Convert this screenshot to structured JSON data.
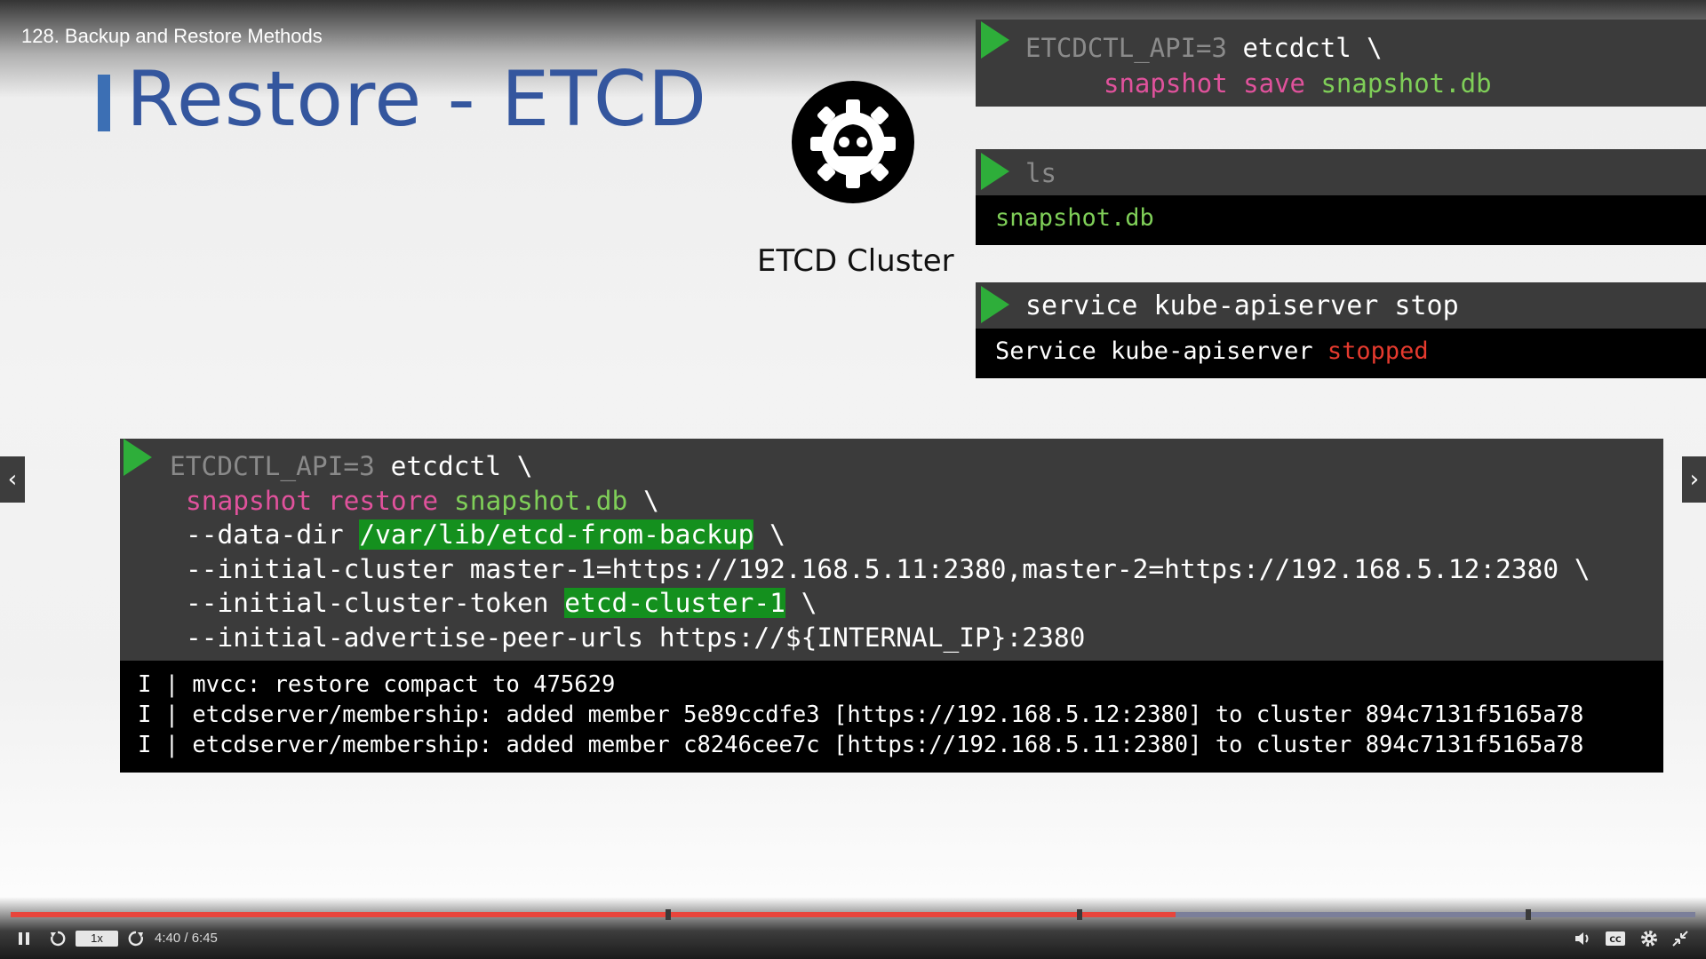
{
  "header": {
    "lecture_title": "128. Backup and Restore Methods"
  },
  "slide": {
    "title": "Restore - ETCD",
    "logo_label": "ETCD Cluster"
  },
  "term1": {
    "env": "ETCDCTL_API=3",
    "cmd": "etcdctl",
    "cont": "\\",
    "sub1": "snapshot",
    "sub2": "save",
    "file": "snapshot.db"
  },
  "term2": {
    "cmd": "ls",
    "output": "snapshot.db"
  },
  "term3": {
    "cmd": "service kube-apiserver stop",
    "output_prefix": "Service kube-apiserver",
    "output_status": "stopped"
  },
  "term4": {
    "env": "ETCDCTL_API=3",
    "cmd": "etcdctl",
    "cont": "\\",
    "sub1": "snapshot",
    "sub2": "restore",
    "file": "snapshot.db",
    "data_dir_flag": "--data-dir",
    "data_dir_value": "/var/lib/etcd-from-backup",
    "initial_cluster_line": "--initial-cluster master-1=https://192.168.5.11:2380,master-2=https://192.168.5.12:2380 \\",
    "token_flag": "--initial-cluster-token",
    "token_value": "etcd-cluster-1",
    "peer_urls_line": "--initial-advertise-peer-urls https://${INTERNAL_IP}:2380",
    "output": [
      "I | mvcc: restore compact to 475629",
      "I | etcdserver/membership: added member 5e89ccdfe3 [https://192.168.5.12:2380] to cluster 894c7131f5165a78",
      "I | etcdserver/membership: added member c8246cee7c [https://192.168.5.11:2380] to cluster 894c7131f5165a78"
    ]
  },
  "nav": {
    "prev": "‹",
    "next": "›"
  },
  "player": {
    "speed": "1x",
    "time": "4:40 / 6:45",
    "progress_fraction": 0.6912,
    "played_color": "#e8453c",
    "track_color": "#7b7f9a",
    "chapter_mark_fractions": [
      0.3905,
      0.6345,
      0.901
    ],
    "icons": [
      "pause-icon",
      "rewind-icon",
      "forward-icon",
      "volume-icon",
      "captions-icon",
      "settings-icon",
      "fullscreen-exit-icon"
    ]
  },
  "colors": {
    "title_blue": "#34569e",
    "prompt_green": "#2eae3a",
    "keyword_pink": "#e0529c",
    "value_green": "#7fcf58",
    "stopped_red": "#e53a2e",
    "highlight_green": "#14901e"
  }
}
